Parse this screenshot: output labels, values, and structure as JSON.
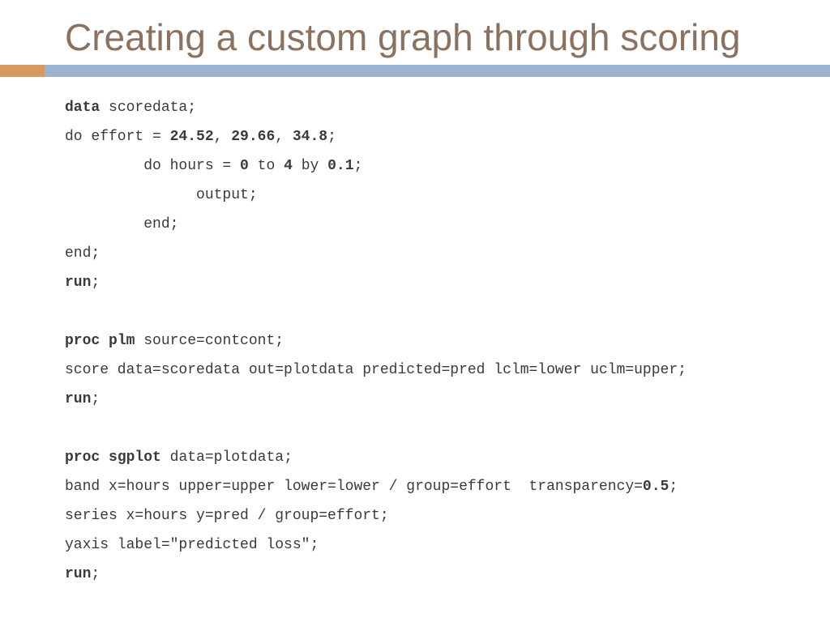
{
  "title": "Creating a custom graph through scoring",
  "code": {
    "l1a": "data",
    "l1b": " scoredata;",
    "l2a": "do effort = ",
    "l2b": "24.52",
    "l2c": ", ",
    "l2d": "29.66",
    "l2e": ", ",
    "l2f": "34.8",
    "l2g": ";",
    "l3a": "         do hours = ",
    "l3b": "0",
    "l3c": " to ",
    "l3d": "4",
    "l3e": " by ",
    "l3f": "0.1",
    "l3g": ";",
    "l4": "               output;",
    "l5": "         end;",
    "l6": "end;",
    "l7": "run",
    "l7b": ";",
    "blank1": " ",
    "l8a": "proc",
    "l8b": " ",
    "l8c": "plm",
    "l8d": " source=contcont;",
    "l9": "score data=scoredata out=plotdata predicted=pred lclm=lower uclm=upper;",
    "l10": "run",
    "l10b": ";",
    "blank2": " ",
    "l11a": "proc",
    "l11b": " ",
    "l11c": "sgplot",
    "l11d": " data=plotdata;",
    "l12a": "band x=hours upper=upper lower=lower / group=effort  transparency=",
    "l12b": "0.5",
    "l12c": ";",
    "l13": "series x=hours y=pred / group=effort;",
    "l14": "yaxis label=\"predicted loss\";",
    "l15": "run",
    "l15b": ";"
  }
}
